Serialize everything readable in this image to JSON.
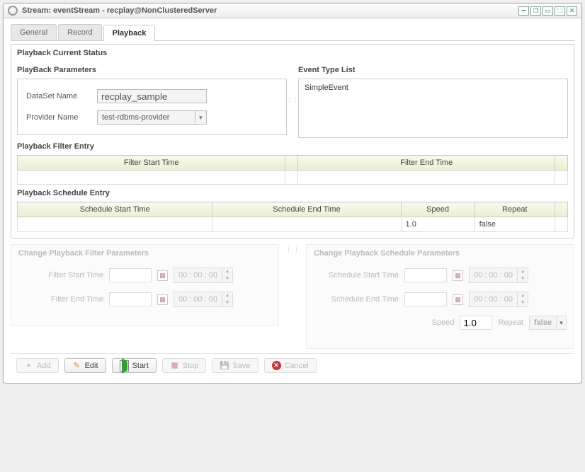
{
  "window": {
    "title": "Stream: eventStream - recplay@NonClusteredServer"
  },
  "tabs": {
    "general": "General",
    "record": "Record",
    "playback": "Playback"
  },
  "status_title": "Playback Current Status",
  "params": {
    "title": "PlayBack Parameters",
    "dataset_label": "DataSet Name",
    "dataset_value": "recplay_sample",
    "provider_label": "Provider Name",
    "provider_value": "test-rdbms-provider"
  },
  "eventlist": {
    "title": "Event Type List",
    "item0": "SimpleEvent"
  },
  "filter_entry": {
    "title": "Playback Filter Entry",
    "col_start": "Filter Start Time",
    "col_end": "Filter End Time"
  },
  "schedule_entry": {
    "title": "Playback Schedule Entry",
    "col_start": "Schedule Start Time",
    "col_end": "Schedule End Time",
    "col_speed": "Speed",
    "col_repeat": "Repeat",
    "row": {
      "start": "",
      "end": "",
      "speed": "1.0",
      "repeat": "false"
    }
  },
  "change_filter": {
    "title": "Change Playback Filter Parameters",
    "start_label": "Filter Start Time",
    "end_label": "Filter End Time",
    "time_value": "00 : 00 : 00"
  },
  "change_schedule": {
    "title": "Change Playback Schedule Parameters",
    "start_label": "Schedule Start Time",
    "end_label": "Schedule End Time",
    "time_value": "00 : 00 : 00",
    "speed_label": "Speed",
    "speed_value": "1.0",
    "repeat_label": "Repeat",
    "repeat_value": "false"
  },
  "toolbar": {
    "add": "Add",
    "edit": "Edit",
    "start": "Start",
    "stop": "Stop",
    "save": "Save",
    "cancel": "Cancel"
  }
}
